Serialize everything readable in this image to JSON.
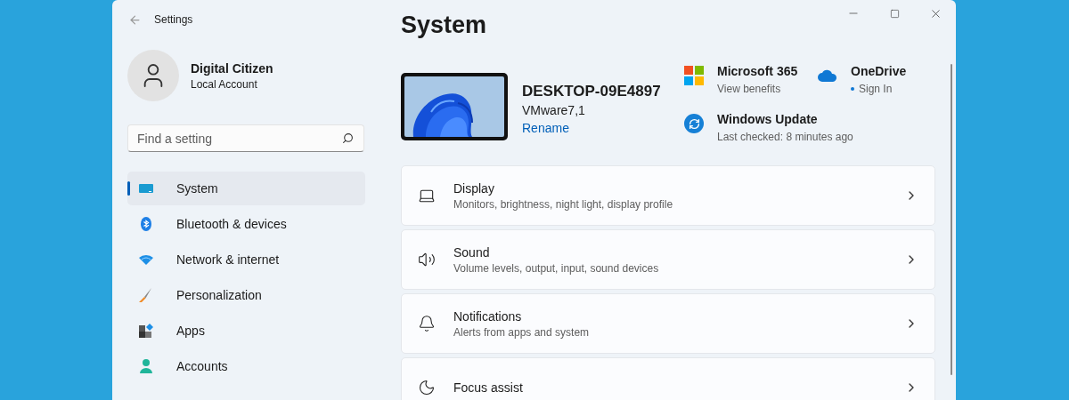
{
  "window": {
    "title": "Settings"
  },
  "account": {
    "name": "Digital Citizen",
    "type": "Local Account"
  },
  "search": {
    "placeholder": "Find a setting"
  },
  "sidebar": {
    "items": [
      {
        "label": "System",
        "selected": true
      },
      {
        "label": "Bluetooth & devices",
        "selected": false
      },
      {
        "label": "Network & internet",
        "selected": false
      },
      {
        "label": "Personalization",
        "selected": false
      },
      {
        "label": "Apps",
        "selected": false
      },
      {
        "label": "Accounts",
        "selected": false
      }
    ]
  },
  "page": {
    "title": "System"
  },
  "device": {
    "name": "DESKTOP-09E4897",
    "model": "VMware7,1",
    "rename_link": "Rename"
  },
  "tiles": [
    {
      "title": "Microsoft 365",
      "subtitle": "View benefits"
    },
    {
      "title": "OneDrive",
      "subtitle": "Sign In"
    },
    {
      "title": "Windows Update",
      "subtitle": "Last checked: 8 minutes ago"
    }
  ],
  "cards": [
    {
      "title": "Display",
      "subtitle": "Monitors, brightness, night light, display profile"
    },
    {
      "title": "Sound",
      "subtitle": "Volume levels, output, input, sound devices"
    },
    {
      "title": "Notifications",
      "subtitle": "Alerts from apps and system"
    },
    {
      "title": "Focus assist"
    }
  ]
}
